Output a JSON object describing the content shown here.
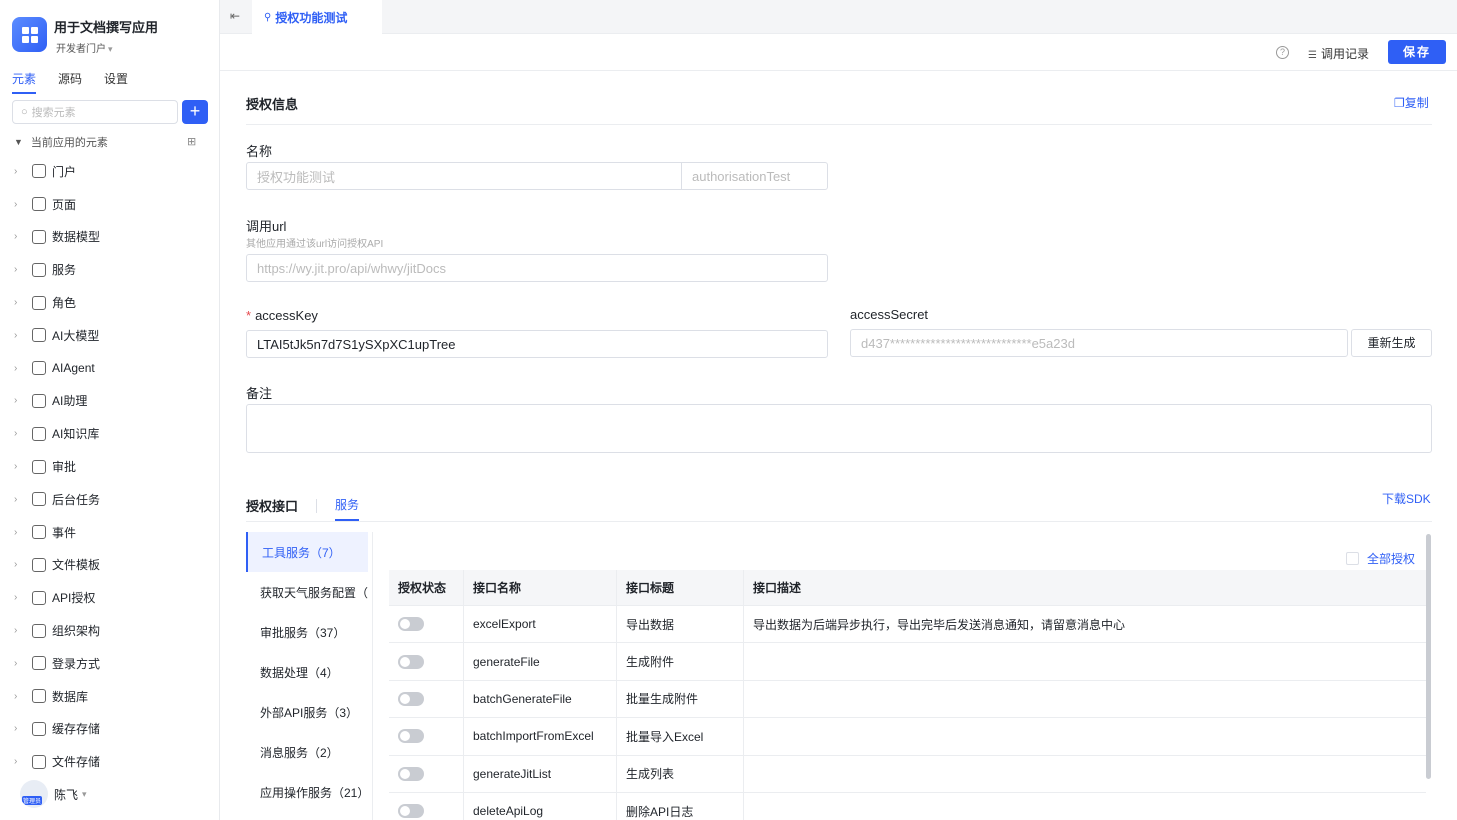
{
  "sidebar": {
    "app_name": "用于文档撰写应用",
    "portal": "开发者门户",
    "tabs": [
      "元素",
      "源码",
      "设置"
    ],
    "search_placeholder": "搜索元素",
    "section": "当前应用的元素",
    "items": [
      {
        "label": "门户",
        "icon": "home-icon"
      },
      {
        "label": "页面",
        "icon": "page-icon"
      },
      {
        "label": "数据模型",
        "icon": "table-icon"
      },
      {
        "label": "服务",
        "icon": "service-icon"
      },
      {
        "label": "角色",
        "icon": "role-icon"
      },
      {
        "label": "AI大模型",
        "icon": "ai-model-icon"
      },
      {
        "label": "AIAgent",
        "icon": "robot-icon"
      },
      {
        "label": "AI助理",
        "icon": "ai-assistant-icon"
      },
      {
        "label": "AI知识库",
        "icon": "book-icon"
      },
      {
        "label": "审批",
        "icon": "stamp-icon"
      },
      {
        "label": "后台任务",
        "icon": "task-icon"
      },
      {
        "label": "事件",
        "icon": "event-icon"
      },
      {
        "label": "文件模板",
        "icon": "file-template-icon"
      },
      {
        "label": "API授权",
        "icon": "key-icon"
      },
      {
        "label": "组织架构",
        "icon": "org-icon"
      },
      {
        "label": "登录方式",
        "icon": "login-icon"
      },
      {
        "label": "数据库",
        "icon": "database-icon"
      },
      {
        "label": "缓存存储",
        "icon": "cache-icon"
      },
      {
        "label": "文件存储",
        "icon": "file-storage-icon"
      }
    ],
    "user": {
      "name": "陈飞",
      "badge": "管理员"
    }
  },
  "topbar": {
    "tab_title": "授权功能测试"
  },
  "toolbar": {
    "call_log": "调用记录",
    "save": "保存"
  },
  "main": {
    "section_title": "授权信息",
    "copy": "复制",
    "name_label": "名称",
    "name_value": "授权功能测试",
    "name_id": "authorisationTest",
    "url_label": "调用url",
    "url_hint": "其他应用通过该url访问授权API",
    "url_value": "https://wy.jit.pro/api/whwy/jitDocs",
    "access_key_label": "accessKey",
    "access_key_value": "LTAI5tJk5n7d7S1ySXpXC1upTree",
    "access_secret_label": "accessSecret",
    "access_secret_value": "d437****************************e5a23d",
    "regen": "重新生成",
    "remark_label": "备注",
    "api_title": "授权接口",
    "api_tab": "服务",
    "download_sdk": "下载SDK",
    "all_auth": "全部授权",
    "services": [
      "工具服务（7）",
      "获取天气服务配置（",
      "审批服务（37）",
      "数据处理（4）",
      "外部API服务（3）",
      "消息服务（2）",
      "应用操作服务（21）"
    ],
    "table_headers": [
      "授权状态",
      "接口名称",
      "接口标题",
      "接口描述"
    ],
    "rows": [
      {
        "name": "excelExport",
        "title": "导出数据",
        "desc": "导出数据为后端异步执行，导出完毕后发送消息通知，请留意消息中心"
      },
      {
        "name": "generateFile",
        "title": "生成附件",
        "desc": ""
      },
      {
        "name": "batchGenerateFile",
        "title": "批量生成附件",
        "desc": ""
      },
      {
        "name": "batchImportFromExcel",
        "title": "批量导入Excel",
        "desc": ""
      },
      {
        "name": "generateJitList",
        "title": "生成列表",
        "desc": ""
      },
      {
        "name": "deleteApiLog",
        "title": "删除API日志",
        "desc": ""
      }
    ]
  },
  "colors": {
    "accent": "#2f5ff5",
    "border": "#dcdfe6"
  }
}
